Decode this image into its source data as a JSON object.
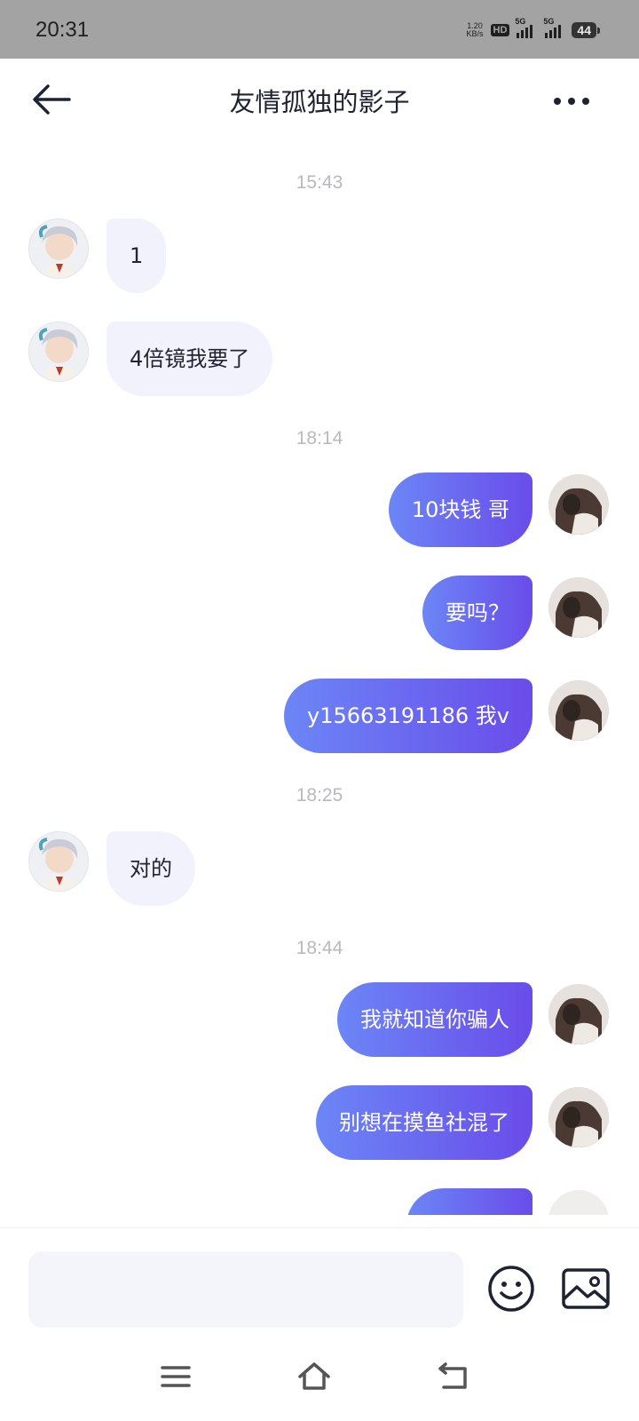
{
  "status_bar": {
    "time": "20:31",
    "net_speed_value": "1.20",
    "net_speed_unit": "KB/s",
    "hd_label": "HD",
    "sim1_label": "5G",
    "sim2_label": "5G",
    "battery": "44"
  },
  "header": {
    "title": "友情孤独的影子",
    "back_icon": "arrow-left-icon",
    "more_icon": "more-horizontal-icon"
  },
  "chat": {
    "timestamps": [
      "15:43",
      "18:14",
      "18:25",
      "18:44"
    ],
    "messages": [
      {
        "side": "in",
        "text": "1"
      },
      {
        "side": "in",
        "text": "4倍镜我要了"
      },
      {
        "side": "out",
        "text": "10块钱 哥"
      },
      {
        "side": "out",
        "text": "要吗？"
      },
      {
        "side": "out",
        "text": "y15663191186 我v"
      },
      {
        "side": "in",
        "text": "对的"
      },
      {
        "side": "out",
        "text": "我就知道你骗人"
      },
      {
        "side": "out",
        "text": "别想在摸鱼社混了"
      }
    ]
  },
  "input_bar": {
    "placeholder": "",
    "emoji_icon": "smiley-face-icon",
    "image_icon": "image-icon"
  },
  "nav_bar": {
    "menu_icon": "menu-icon",
    "home_icon": "home-icon",
    "back_icon": "back-icon"
  },
  "colors": {
    "status_bar_bg": "#a3a3a3",
    "bubble_in_bg": "#f1f2fb",
    "bubble_out_start": "#6b86f6",
    "bubble_out_end": "#6a4cea",
    "timestamp_text": "#b7b9c2",
    "icon_dark": "#1f2233"
  }
}
